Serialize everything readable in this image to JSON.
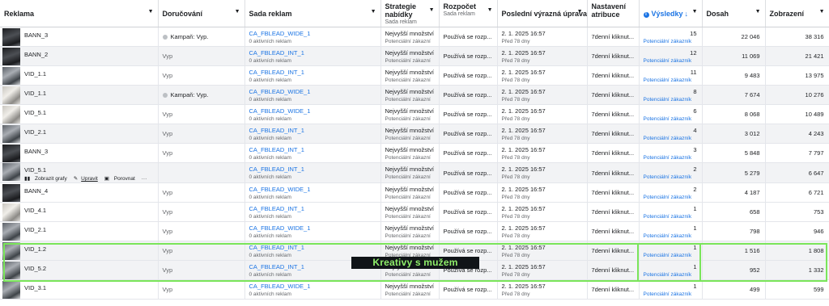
{
  "headers": {
    "reklama": "Reklama",
    "doruceni": "Doručování",
    "sada": "Sada reklam",
    "strategie_l1": "Strategie",
    "strategie_l2": "nabídky",
    "strategie_sub": "Sada reklam",
    "rozpocet": "Rozpočet",
    "rozpocet_sub": "Sada reklam",
    "uprava": "Poslední výrazná úprava",
    "nastaveni_l1": "Nastavení",
    "nastaveni_l2": "atribuce",
    "vysledky": "Výsledky",
    "dosah": "Dosah",
    "zobrazeni": "Zobrazení"
  },
  "row_actions": {
    "charts": "Zobrazit grafy",
    "edit": "Upravit",
    "compare": "Porovnat",
    "more": "···"
  },
  "overlay": {
    "label": "Kreativy s mužem"
  },
  "colors": {
    "highlight": "#7ae55a",
    "link": "#1b74e4",
    "overlay_text": "#8ff06a"
  },
  "rows": [
    {
      "name": "BANN_3",
      "delivery": "Kampaň: Vyp.",
      "adset": "CA_FBLEAD_WIDE_1",
      "adset_sub": "0 aktivních reklam",
      "strategy": "Nejvyšší množství",
      "strategy_sub": "Potenciální zákazní",
      "budget": "Používá se rozp...",
      "edit": "2. 1. 2025 16:57",
      "edit_sub": "Před 78 dny",
      "attribution": "7denní kliknut...",
      "results": "15",
      "results_sub": "Potenciální zákazník",
      "reach": "22 046",
      "impressions": "38 316"
    },
    {
      "name": "BANN_2",
      "delivery": "Vyp",
      "adset": "CA_FBLEAD_INT_1",
      "adset_sub": "0 aktivních reklam",
      "strategy": "Nejvyšší množství",
      "strategy_sub": "Potenciální zákazní",
      "budget": "Používá se rozp...",
      "edit": "2. 1. 2025 16:57",
      "edit_sub": "Před 78 dny",
      "attribution": "7denní kliknut...",
      "results": "12",
      "results_sub": "Potenciální zákazník",
      "reach": "11 069",
      "impressions": "21 421"
    },
    {
      "name": "VID_1.1",
      "delivery": "Vyp",
      "adset": "CA_FBLEAD_INT_1",
      "adset_sub": "0 aktivních reklam",
      "strategy": "Nejvyšší množství",
      "strategy_sub": "Potenciální zákazní",
      "budget": "Používá se rozp...",
      "edit": "2. 1. 2025 16:57",
      "edit_sub": "Před 78 dny",
      "attribution": "7denní kliknut...",
      "results": "11",
      "results_sub": "Potenciální zákazník",
      "reach": "9 483",
      "impressions": "13 975"
    },
    {
      "name": "VID_1.1",
      "delivery": "Kampaň: Vyp.",
      "adset": "CA_FBLEAD_WIDE_1",
      "adset_sub": "0 aktivních reklam",
      "strategy": "Nejvyšší množství",
      "strategy_sub": "Potenciální zákazní",
      "budget": "Používá se rozp...",
      "edit": "2. 1. 2025 16:57",
      "edit_sub": "Před 78 dny",
      "attribution": "7denní kliknut...",
      "results": "8",
      "results_sub": "Potenciální zákazník",
      "reach": "7 674",
      "impressions": "10 276"
    },
    {
      "name": "VID_5.1",
      "delivery": "Vyp",
      "adset": "CA_FBLEAD_WIDE_1",
      "adset_sub": "0 aktivních reklam",
      "strategy": "Nejvyšší množství",
      "strategy_sub": "Potenciální zákazní",
      "budget": "Používá se rozp...",
      "edit": "2. 1. 2025 16:57",
      "edit_sub": "Před 78 dny",
      "attribution": "7denní kliknut...",
      "results": "6",
      "results_sub": "Potenciální zákazník",
      "reach": "8 068",
      "impressions": "10 489"
    },
    {
      "name": "VID_2.1",
      "delivery": "Vyp",
      "adset": "CA_FBLEAD_INT_1",
      "adset_sub": "0 aktivních reklam",
      "strategy": "Nejvyšší množství",
      "strategy_sub": "Potenciální zákazní",
      "budget": "Používá se rozp...",
      "edit": "2. 1. 2025 16:57",
      "edit_sub": "Před 78 dny",
      "attribution": "7denní kliknut...",
      "results": "4",
      "results_sub": "Potenciální zákazník",
      "reach": "3 012",
      "impressions": "4 243"
    },
    {
      "name": "BANN_3",
      "delivery": "Vyp",
      "adset": "CA_FBLEAD_INT_1",
      "adset_sub": "0 aktivních reklam",
      "strategy": "Nejvyšší množství",
      "strategy_sub": "Potenciální zákazní",
      "budget": "Používá se rozp...",
      "edit": "2. 1. 2025 16:57",
      "edit_sub": "Před 78 dny",
      "attribution": "7denní kliknut...",
      "results": "3",
      "results_sub": "Potenciální zákazník",
      "reach": "5 848",
      "impressions": "7 797"
    },
    {
      "name": "VID_5.1",
      "delivery": "",
      "adset": "CA_FBLEAD_INT_1",
      "adset_sub": "0 aktivních reklam",
      "strategy": "Nejvyšší množství",
      "strategy_sub": "Potenciální zákazní",
      "budget": "Používá se rozp...",
      "edit": "2. 1. 2025 16:57",
      "edit_sub": "Před 78 dny",
      "attribution": "7denní kliknut...",
      "results": "2",
      "results_sub": "Potenciální zákazník",
      "reach": "5 279",
      "impressions": "6 647"
    },
    {
      "name": "BANN_4",
      "delivery": "Vyp",
      "adset": "CA_FBLEAD_WIDE_1",
      "adset_sub": "0 aktivních reklam",
      "strategy": "Nejvyšší množství",
      "strategy_sub": "Potenciální zákazní",
      "budget": "Používá se rozp...",
      "edit": "2. 1. 2025 16:57",
      "edit_sub": "Před 78 dny",
      "attribution": "7denní kliknut...",
      "results": "2",
      "results_sub": "Potenciální zákazník",
      "reach": "4 187",
      "impressions": "6 721"
    },
    {
      "name": "VID_4.1",
      "delivery": "Vyp",
      "adset": "CA_FBLEAD_INT_1",
      "adset_sub": "0 aktivních reklam",
      "strategy": "Nejvyšší množství",
      "strategy_sub": "Potenciální zákazní",
      "budget": "Používá se rozp...",
      "edit": "2. 1. 2025 16:57",
      "edit_sub": "Před 78 dny",
      "attribution": "7denní kliknut...",
      "results": "1",
      "results_sub": "Potenciální zákazník",
      "reach": "658",
      "impressions": "753"
    },
    {
      "name": "VID_2.1",
      "delivery": "Vyp",
      "adset": "CA_FBLEAD_WIDE_1",
      "adset_sub": "0 aktivních reklam",
      "strategy": "Nejvyšší množství",
      "strategy_sub": "Potenciální zákazní",
      "budget": "Používá se rozp...",
      "edit": "2. 1. 2025 16:57",
      "edit_sub": "Před 78 dny",
      "attribution": "7denní kliknut...",
      "results": "1",
      "results_sub": "Potenciální zákazník",
      "reach": "798",
      "impressions": "946"
    },
    {
      "name": "VID_1.2",
      "delivery": "Vyp",
      "adset": "CA_FBLEAD_INT_1",
      "adset_sub": "0 aktivních reklam",
      "strategy": "Nejvyšší množství",
      "strategy_sub": "Potenciální zákazní",
      "budget": "Používá se rozp...",
      "edit": "2. 1. 2025 16:57",
      "edit_sub": "Před 78 dny",
      "attribution": "7denní kliknut...",
      "results": "1",
      "results_sub": "Potenciální zákazník",
      "reach": "1 516",
      "impressions": "1 808"
    },
    {
      "name": "VID_5.2",
      "delivery": "Vyp",
      "adset": "CA_FBLEAD_INT_1",
      "adset_sub": "0 aktivních reklam",
      "strategy": "Nejvyšší množství",
      "strategy_sub": "Potenciální zákazní",
      "budget": "Používá se rozp...",
      "edit": "2. 1. 2025 16:57",
      "edit_sub": "Před 78 dny",
      "attribution": "7denní kliknut...",
      "results": "1",
      "results_sub": "Potenciální zákazník",
      "reach": "952",
      "impressions": "1 332"
    },
    {
      "name": "VID_3.1",
      "delivery": "Vyp",
      "adset": "CA_FBLEAD_WIDE_1",
      "adset_sub": "0 aktivních reklam",
      "strategy": "Nejvyšší množství",
      "strategy_sub": "Potenciální zákazní",
      "budget": "Používá se rozp...",
      "edit": "2. 1. 2025 16:57",
      "edit_sub": "Před 78 dny",
      "attribution": "7denní kliknut...",
      "results": "1",
      "results_sub": "Potenciální zákazník",
      "reach": "499",
      "impressions": "599"
    }
  ]
}
